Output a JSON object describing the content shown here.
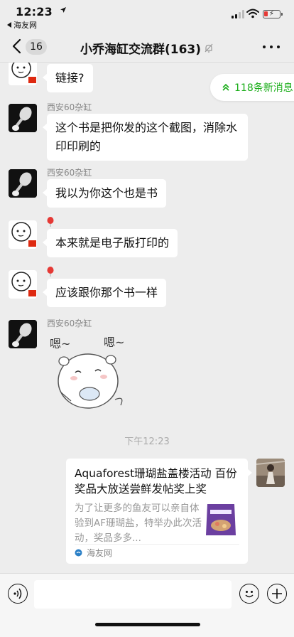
{
  "status_bar": {
    "time": "12:23",
    "back_app": "海友网"
  },
  "nav": {
    "unread_count": "16",
    "title": "小乔海缸交流群(163)"
  },
  "new_messages_pill": "118条新消息",
  "messages": [
    {
      "sender": "",
      "text": "链接?"
    },
    {
      "sender": "西安60杂缸",
      "text": "这个书是把你发的这个截图，消除水印印刷的"
    },
    {
      "sender": "西安60杂缸",
      "text": "我以为你这个也是书"
    },
    {
      "sender": "",
      "text": "本来就是电子版打印的"
    },
    {
      "sender": "",
      "text": "应该跟你那个书一样"
    },
    {
      "sender": "西安60杂缸",
      "sticker_text_left": "嗯~",
      "sticker_text_right": "嗯~"
    }
  ],
  "timestamp": "下午12:23",
  "link_card": {
    "title": "Aquaforest珊瑚盐盖楼活动 百份奖品大放送尝鲜发帖奖上奖",
    "description": "为了让更多的鱼友可以亲自体验到AF珊瑚盐，特举办此次活动，奖品多多...",
    "source": "海友网"
  },
  "colors": {
    "background": "#ededed",
    "bubble": "#ffffff",
    "accent_green": "#1aad19",
    "battery_red": "#e53935"
  }
}
